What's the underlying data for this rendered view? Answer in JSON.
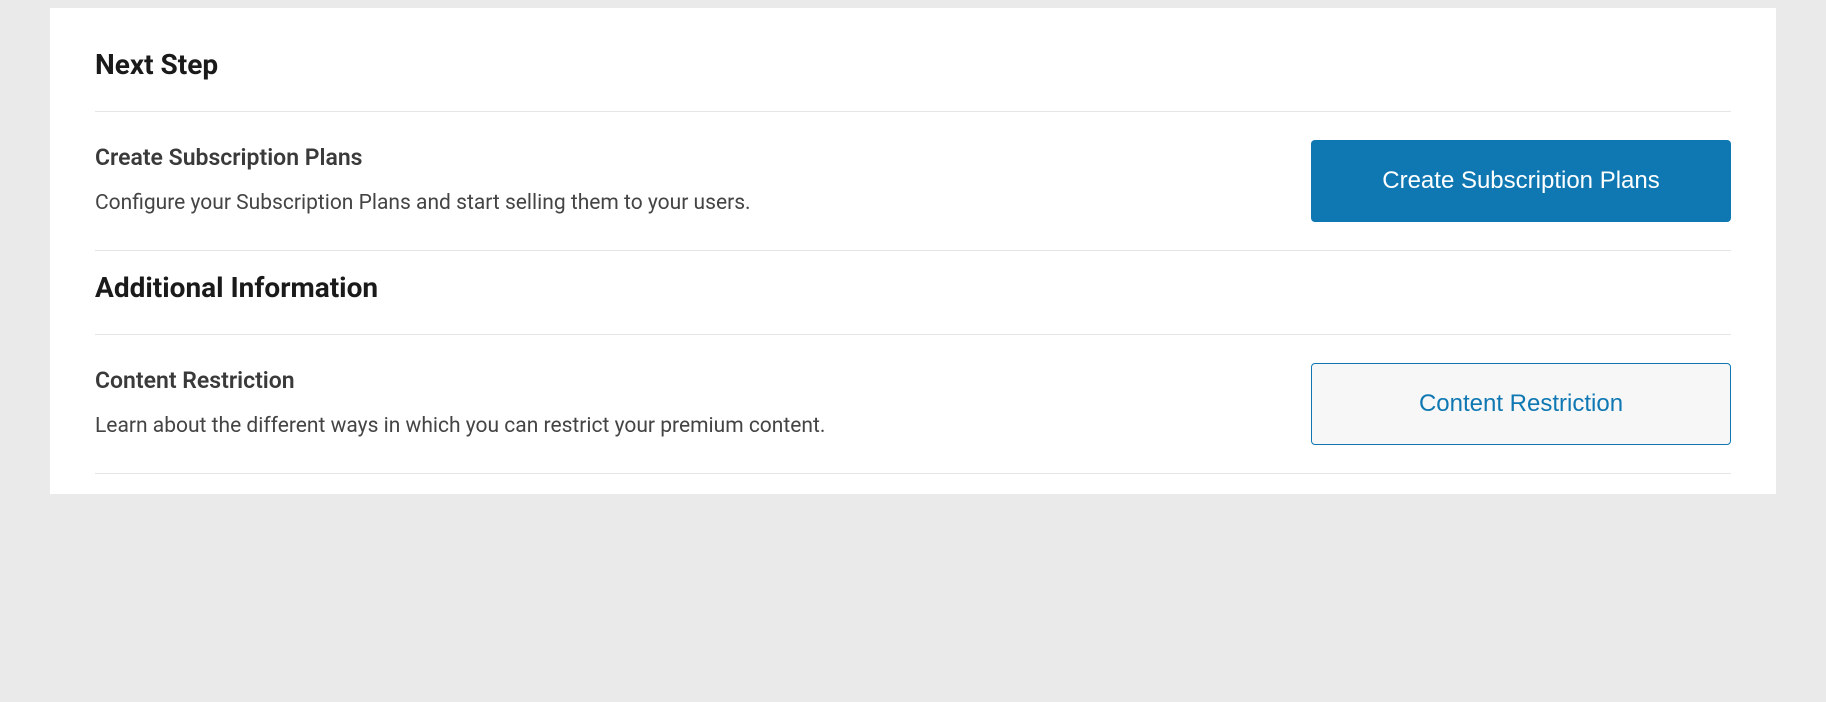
{
  "next_step": {
    "heading": "Next Step",
    "create_plans": {
      "title": "Create Subscription Plans",
      "description": "Configure your Subscription Plans and start selling them to your users.",
      "button_label": "Create Subscription Plans"
    }
  },
  "additional_info": {
    "heading": "Additional Information",
    "content_restriction": {
      "title": "Content Restriction",
      "description": "Learn about the different ways in which you can restrict your premium content.",
      "button_label": "Content Restriction"
    }
  }
}
